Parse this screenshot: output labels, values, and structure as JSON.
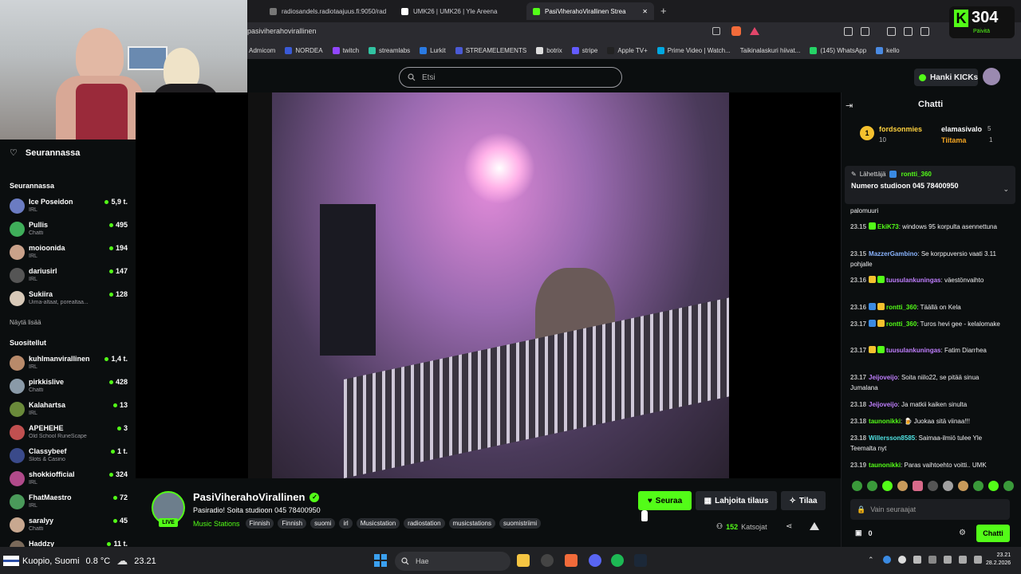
{
  "browser": {
    "tabs": [
      {
        "title": "radiosandels.radiotaajuus.fi:9050/rad"
      },
      {
        "title": "UMK26 | UMK26 | Yle Areena"
      },
      {
        "title": "PasiViherahoVirallinen Strea"
      }
    ],
    "new_tab": "+",
    "close": "✕",
    "url": "pasiviherahovirallinen",
    "bookmarks": [
      "Admicom",
      "NORDEA",
      "twitch",
      "streamlabs",
      "Lurkit",
      "STREAMELEMENTS",
      "botrix",
      "stripe",
      "Apple TV+",
      "Prime Video | Watch...",
      "Taikinalaskuri hiivat...",
      "(145) WhatsApp",
      "kello"
    ]
  },
  "kick_widget": {
    "count": "304",
    "label": "Päivitä"
  },
  "header": {
    "search_placeholder": "Etsi",
    "kicks_button": "Hanki KICKs"
  },
  "sidebar": {
    "following_title": "Seurannassa",
    "following_section": "Seurannassa",
    "following": [
      {
        "name": "Ice Poseidon",
        "category": "IRL",
        "viewers": "5,9 t.",
        "color": "#6b7cc2"
      },
      {
        "name": "Pullis",
        "category": "Chatti",
        "viewers": "495",
        "color": "#3fae5a"
      },
      {
        "name": "moioonida",
        "category": "IRL",
        "viewers": "194",
        "color": "#c9a18a"
      },
      {
        "name": "dariusirl",
        "category": "IRL",
        "viewers": "147",
        "color": "#555"
      },
      {
        "name": "Sukiira",
        "category": "Uima-altaat, porealtaa...",
        "viewers": "128",
        "color": "#d8c9b8"
      }
    ],
    "show_more": "Näytä lisää",
    "recommended_section": "Suositellut",
    "recommended": [
      {
        "name": "kuhlmanvirallinen",
        "category": "IRL",
        "viewers": "1,4 t.",
        "color": "#b88a6a"
      },
      {
        "name": "pirkkislive",
        "category": "Chatti",
        "viewers": "428",
        "color": "#8a9aa8"
      },
      {
        "name": "Kalahartsa",
        "category": "IRL",
        "viewers": "13",
        "color": "#6a8a3a"
      },
      {
        "name": "APEHEHE",
        "category": "Old School RuneScape",
        "viewers": "3",
        "color": "#c05050"
      },
      {
        "name": "Classybeef",
        "category": "Slots & Casino",
        "viewers": "1 t.",
        "color": "#3a4a8a"
      },
      {
        "name": "shokkiofficial",
        "category": "IRL",
        "viewers": "324",
        "color": "#b04a8a"
      },
      {
        "name": "FhatMaestro",
        "category": "IRL",
        "viewers": "72",
        "color": "#4a9a5a"
      },
      {
        "name": "saralyy",
        "category": "Chatti",
        "viewers": "45",
        "color": "#c8a890"
      },
      {
        "name": "Haddzy",
        "category": "",
        "viewers": "11 t.",
        "color": "#7a6a5a"
      }
    ]
  },
  "stream": {
    "streamer": "PasiViherahoVirallinen",
    "title": "Pasiradio! Soita studioon 045 78400950",
    "live": "LIVE",
    "category": "Music Stations",
    "tags": [
      "Finnish",
      "Finnish",
      "suomi",
      "irl",
      "Musicstation",
      "radiostation",
      "musicstations",
      "suomistriimi"
    ],
    "follow": "Seuraa",
    "gift": "Lahjoita tilaus",
    "subscribe": "Tilaa",
    "viewers": "152",
    "viewers_label": "Katsojat"
  },
  "chat": {
    "title": "Chatti",
    "top_gifters": [
      {
        "name": "fordsonmies",
        "count": "10"
      },
      {
        "name": "elamasivalo",
        "count": "5"
      },
      {
        "name": "Tiitama",
        "count": "1"
      }
    ],
    "pinned": {
      "sender_label": "Lähettäjä",
      "sender": "rontti_360",
      "text": "Numero studioon 045 78400950"
    },
    "partial_message": "palomuuri",
    "messages": [
      {
        "time": "23.15",
        "user": "EkiK73",
        "color": "#53fc18",
        "text": "windows 95 korpulta asennettuna"
      },
      {
        "time": "23.15",
        "user": "MazzerGambino",
        "color": "#8ab4ff",
        "text": "Se korppuversio vaati 3.11 pohjalle"
      },
      {
        "time": "23.16",
        "user": "tuusulankuningas",
        "color": "#c07fff",
        "text": "väestönvaihto"
      },
      {
        "time": "23.16",
        "user": "rontti_360",
        "color": "#53fc18",
        "text": "Täällä on Kela"
      },
      {
        "time": "23.17",
        "user": "rontti_360",
        "color": "#53fc18",
        "text": "Turos hevi gee - kelalomake"
      },
      {
        "time": "23.17",
        "user": "tuusulankuningas",
        "color": "#c07fff",
        "text": "Fatim Diarrhea"
      },
      {
        "time": "23.17",
        "user": "Jeijoveijo",
        "color": "#c07fff",
        "text": "Soita niilo22, se pitää sinua Jumalana"
      },
      {
        "time": "23.18",
        "user": "Jeijoveijo",
        "color": "#c07fff",
        "text": "Ja matkii kaiken sinulta"
      },
      {
        "time": "23.18",
        "user": "taunonikki",
        "color": "#53fc18",
        "text": "Juokaa sitä viinaa!!!"
      },
      {
        "time": "23.18",
        "user": "Willersson8585",
        "color": "#50e3e3",
        "text": "Saimaa-ilmiö tulee Yle Teemalta nyt"
      },
      {
        "time": "23.19",
        "user": "taunonikki",
        "color": "#53fc18",
        "text": "Paras vaihtoehto voitti.. UMK"
      }
    ],
    "input_placeholder": "Vain seuraajat",
    "points": "0",
    "send": "Chatti"
  },
  "taskbar": {
    "location": "Kuopio, Suomi",
    "temperature": "0.8 °C",
    "weather_time": "23.21",
    "search_placeholder": "Hae",
    "time": "23.21",
    "date": "28.2.2026"
  }
}
